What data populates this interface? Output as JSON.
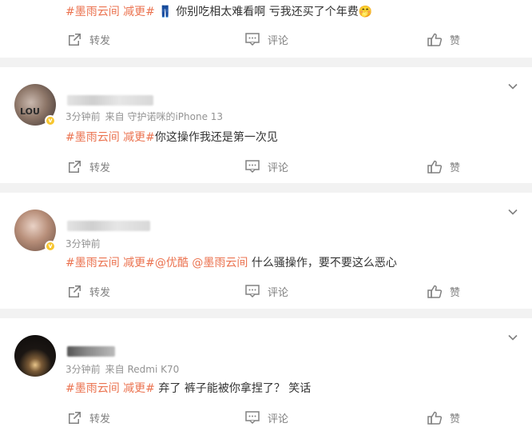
{
  "actions": {
    "forward": "转发",
    "comment": "评论",
    "like": "赞"
  },
  "posts": [
    {
      "tag": "#墨雨云间 减更#",
      "emoji_pants": "👖",
      "text": "你别吃相太难看啊 亏我还买了个年费",
      "emoji_face": "🤭"
    },
    {
      "time": "3分钟前",
      "source": "来自 守护诺咪的iPhone 13",
      "tag": "#墨雨云间 减更#",
      "text": "你这操作我还是第一次见"
    },
    {
      "time": "3分钟前",
      "tag": "#墨雨云间 减更#",
      "mention1": "@优酷",
      "mention2": "@墨雨云间",
      "text": "什么骚操作，要不要这么恶心"
    },
    {
      "time": "3分钟前",
      "source": "来自 Redmi K70",
      "tag": "#墨雨云间 减更#",
      "text": "弃了 裤子能被你拿捏了？ 笑话"
    }
  ],
  "colors": {
    "accent": "#eb7350",
    "meta": "#939393",
    "action": "#808080",
    "badge": "#f7c62f"
  }
}
